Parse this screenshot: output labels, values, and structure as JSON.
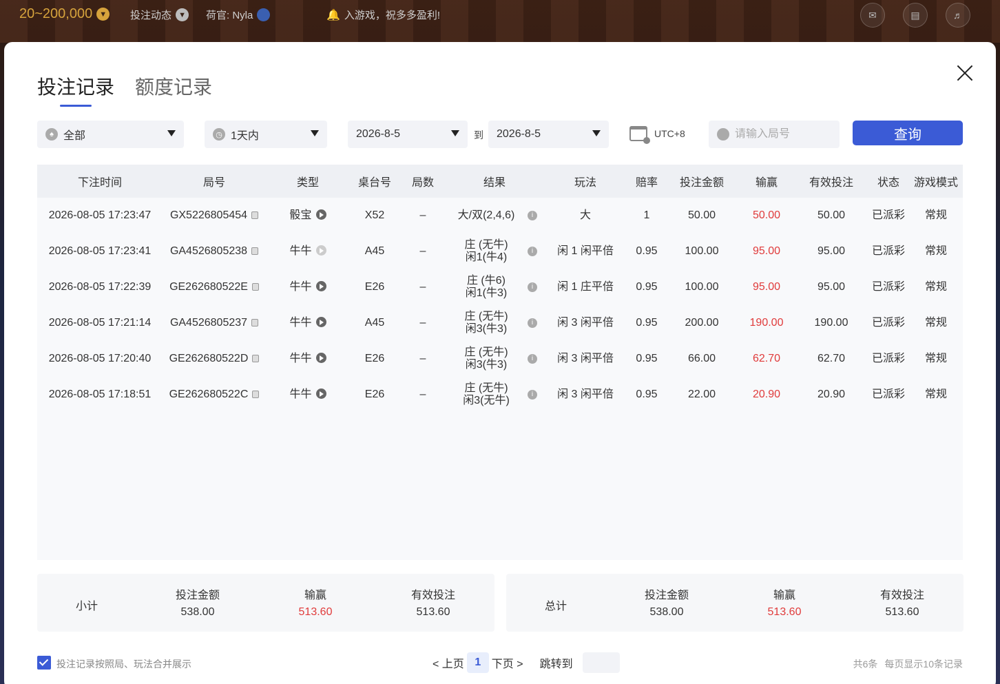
{
  "topbar": {
    "range": "20~200,000",
    "bet_dynamics": "投注动态",
    "dealer": "荷官: Nyla",
    "marquee": "入游戏，祝多多盈利!"
  },
  "tabs": [
    "投注记录",
    "额度记录"
  ],
  "filters": {
    "game_type": "全部",
    "period": "1天内",
    "date_from": "2026-8-5",
    "to_label": "到",
    "date_to": "2026-8-5",
    "timezone": "UTC+8",
    "round_placeholder": "请输入局号",
    "query_label": "查询"
  },
  "table": {
    "headers": [
      "下注时间",
      "局号",
      "类型",
      "桌台号",
      "局数",
      "结果",
      "玩法",
      "赔率",
      "投注金额",
      "输赢",
      "有效投注",
      "状态",
      "游戏模式"
    ],
    "rows": [
      {
        "time": "2026-08-05 17:23:47",
        "round": "GX5226805454",
        "type": "骰宝",
        "table": "X52",
        "count": "–",
        "result1": "大/双(2,4,6)",
        "result2": "",
        "play": "大",
        "odds": "1",
        "bet": "50.00",
        "win": "50.00",
        "valid": "50.00",
        "status": "已派彩",
        "mode": "常规"
      },
      {
        "time": "2026-08-05 17:23:41",
        "round": "GA4526805238",
        "type": "牛牛",
        "table": "A45",
        "count": "–",
        "result1": "庄 (无牛)",
        "result2": "闲1(牛4)",
        "play": "闲 1 闲平倍",
        "odds": "0.95",
        "bet": "100.00",
        "win": "95.00",
        "valid": "95.00",
        "status": "已派彩",
        "mode": "常规"
      },
      {
        "time": "2026-08-05 17:22:39",
        "round": "GE262680522E",
        "type": "牛牛",
        "table": "E26",
        "count": "–",
        "result1": "庄 (牛6)",
        "result2": "闲1(牛3)",
        "play": "闲 1 庄平倍",
        "odds": "0.95",
        "bet": "100.00",
        "win": "95.00",
        "valid": "95.00",
        "status": "已派彩",
        "mode": "常规"
      },
      {
        "time": "2026-08-05 17:21:14",
        "round": "GA4526805237",
        "type": "牛牛",
        "table": "A45",
        "count": "–",
        "result1": "庄 (无牛)",
        "result2": "闲3(牛3)",
        "play": "闲 3 闲平倍",
        "odds": "0.95",
        "bet": "200.00",
        "win": "190.00",
        "valid": "190.00",
        "status": "已派彩",
        "mode": "常规"
      },
      {
        "time": "2026-08-05 17:20:40",
        "round": "GE262680522D",
        "type": "牛牛",
        "table": "E26",
        "count": "–",
        "result1": "庄 (无牛)",
        "result2": "闲3(牛3)",
        "play": "闲 3 闲平倍",
        "odds": "0.95",
        "bet": "66.00",
        "win": "62.70",
        "valid": "62.70",
        "status": "已派彩",
        "mode": "常规"
      },
      {
        "time": "2026-08-05 17:18:51",
        "round": "GE262680522C",
        "type": "牛牛",
        "table": "E26",
        "count": "–",
        "result1": "庄 (无牛)",
        "result2": "闲3(无牛)",
        "play": "闲 3 闲平倍",
        "odds": "0.95",
        "bet": "22.00",
        "win": "20.90",
        "valid": "20.90",
        "status": "已派彩",
        "mode": "常规"
      }
    ]
  },
  "subtotal": {
    "title": "小计",
    "bet_label": "投注金额",
    "bet": "538.00",
    "win_label": "输赢",
    "win": "513.60",
    "valid_label": "有效投注",
    "valid": "513.60"
  },
  "total": {
    "title": "总计",
    "bet_label": "投注金额",
    "bet": "538.00",
    "win_label": "输赢",
    "win": "513.60",
    "valid_label": "有效投注",
    "valid": "513.60"
  },
  "footer": {
    "merge_label": "投注记录按照局、玩法合并展示",
    "prev": "< 上页",
    "current_page": "1",
    "next": "下页 >",
    "jump_label": "跳转到",
    "total_count": "共6条",
    "per_page": "每页显示10条记录"
  },
  "colors": {
    "accent": "#3b5bd6",
    "win": "#e03b3b",
    "gold": "#d6a33c"
  }
}
